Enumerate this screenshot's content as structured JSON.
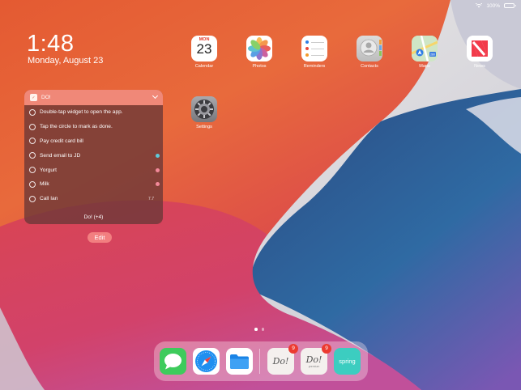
{
  "status_bar": {
    "battery_percent": "100%",
    "battery_level": 1.0
  },
  "lock": {
    "time": "1:48",
    "date": "Monday, August 23"
  },
  "widget": {
    "title": "DO!",
    "tasks": [
      {
        "text": "Double-tap widget to open the app.",
        "tag_color": "",
        "count": ""
      },
      {
        "text": "Tap the circle to mark as done.",
        "tag_color": "",
        "count": ""
      },
      {
        "text": "Pay credit card bill",
        "tag_color": "",
        "count": ""
      },
      {
        "text": "Send email to JD",
        "tag_color": "#5fc9d9",
        "count": ""
      },
      {
        "text": "Yorgurt",
        "tag_color": "#f3899a",
        "count": ""
      },
      {
        "text": "Milk",
        "tag_color": "#f3899a",
        "count": ""
      },
      {
        "text": "Call Ian",
        "tag_color": "",
        "count": "7.7"
      }
    ],
    "footer": "Do! (+4)"
  },
  "edit_button": "Edit",
  "apps": [
    {
      "name": "Calendar",
      "icon": "calendar-icon",
      "cal_day": "MON",
      "cal_date": "23"
    },
    {
      "name": "Photos",
      "icon": "photos-icon"
    },
    {
      "name": "Reminders",
      "icon": "reminders-icon"
    },
    {
      "name": "Contacts",
      "icon": "contacts-icon"
    },
    {
      "name": "Maps",
      "icon": "maps-icon",
      "badge_text": "280"
    },
    {
      "name": "News",
      "icon": "news-icon"
    },
    {
      "name": "Settings",
      "icon": "settings-icon"
    }
  ],
  "page_indicator": {
    "pages": 2,
    "current": 1
  },
  "dock": {
    "apps": [
      {
        "id": "messages",
        "icon": "messages-icon"
      },
      {
        "id": "safari",
        "icon": "safari-icon"
      },
      {
        "id": "files",
        "icon": "files-icon"
      },
      {
        "id": "do",
        "icon": "do-app-icon",
        "label": "Do!",
        "badge": "9"
      },
      {
        "id": "do-premium",
        "icon": "do-premium-icon",
        "label": "Do!",
        "sublabel": "premium",
        "badge": "9"
      },
      {
        "id": "spring",
        "icon": "spring-icon",
        "label": "spring"
      }
    ]
  },
  "colors": {
    "wallpaper_orange": "#e2622f",
    "wallpaper_red": "#d8424f",
    "wallpaper_blue": "#2d5e98",
    "widget_header": "#f08878",
    "edit_button": "#f27f80",
    "badge": "#ec3a30",
    "tag_blue": "#5fc9d9",
    "tag_pink": "#f3899a"
  }
}
